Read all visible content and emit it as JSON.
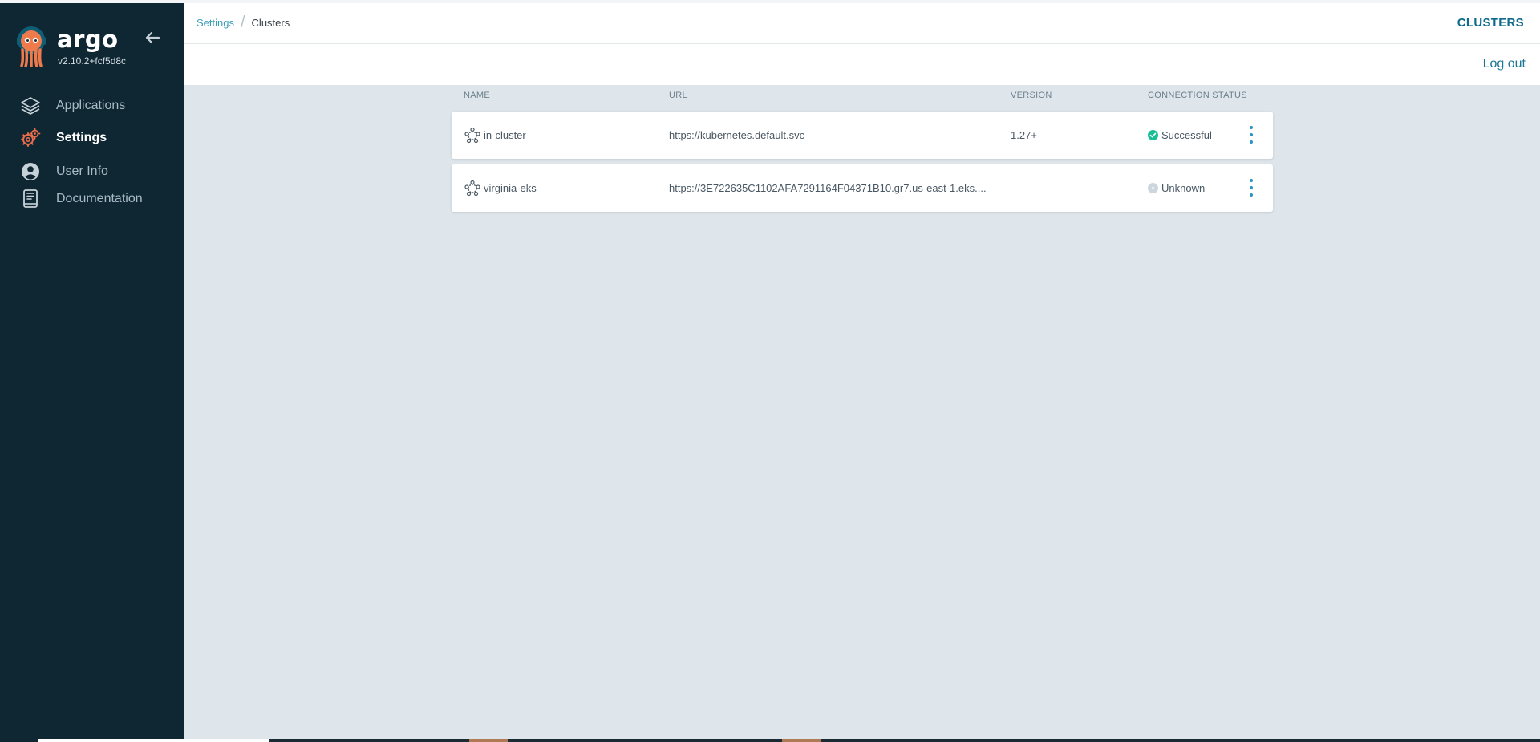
{
  "app": {
    "brand": "argo",
    "version": "v2.10.2+fcf5d8c"
  },
  "sidebar": {
    "items": [
      {
        "label": "Applications",
        "icon": "layers-icon"
      },
      {
        "label": "Settings",
        "icon": "gears-icon",
        "active": true
      },
      {
        "label": "User Info",
        "icon": "user-circle-icon"
      },
      {
        "label": "Documentation",
        "icon": "book-icon"
      }
    ]
  },
  "header": {
    "breadcrumb": [
      "Settings",
      "Clusters"
    ],
    "title": "CLUSTERS"
  },
  "toolbar": {
    "logout": "Log out"
  },
  "table": {
    "columns": [
      "NAME",
      "URL",
      "VERSION",
      "CONNECTION STATUS"
    ],
    "rows": [
      {
        "name": "in-cluster",
        "url": "https://kubernetes.default.svc",
        "version": "1.27+",
        "status": "Successful"
      },
      {
        "name": "virginia-eks",
        "url": "https://3E722635C1102AFA7291164F04371B10.gr7.us-east-1.eks....",
        "version": "",
        "status": "Unknown"
      }
    ]
  },
  "colors": {
    "sidebar_bg": "#0f2733",
    "page_bg": "#dee6eb",
    "accent": "#1b7696",
    "success": "#18be94",
    "unknown": "#ccd6dd",
    "active_icon": "#e96d4c"
  }
}
